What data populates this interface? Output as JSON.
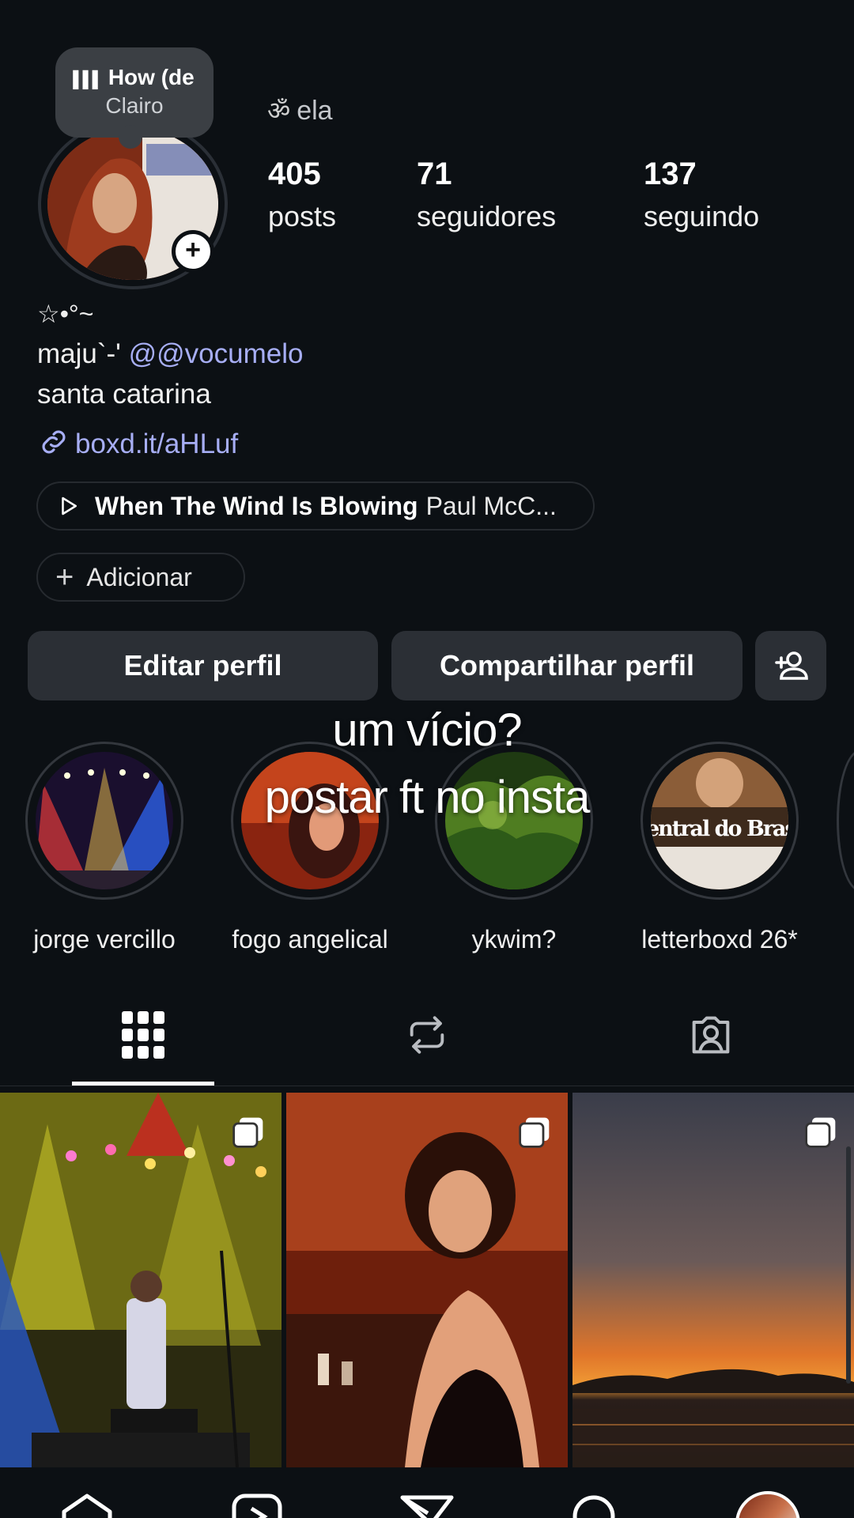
{
  "profile": {
    "note": {
      "title": "How (de",
      "artist": "Clairo"
    },
    "pronoun_icon": "ॐ",
    "pronoun": "ela",
    "stats": [
      {
        "value": "405",
        "label": "posts"
      },
      {
        "value": "71",
        "label": "seguidores"
      },
      {
        "value": "137",
        "label": "seguindo"
      }
    ],
    "bio_symbols": "☆•°~",
    "name": "maju`-'",
    "threads_handle": "@vocumelo",
    "location": "santa catarina",
    "link": "boxd.it/aHLuf",
    "music": {
      "title": "When The Wind Is Blowing",
      "artist": "Paul McC..."
    },
    "add_label": "Adicionar"
  },
  "buttons": {
    "edit": "Editar perfil",
    "share": "Compartilhar perfil"
  },
  "overlay": {
    "line1": "um vício?",
    "line2": "postar ft no insta"
  },
  "highlights": [
    {
      "label": "jorge vercillo"
    },
    {
      "label": "fogo angelical"
    },
    {
      "label": "ykwim?"
    },
    {
      "label": "letterboxd 26*",
      "image_text": "entral do Brasi"
    }
  ],
  "tabs": [
    "grid-icon",
    "reposts-icon",
    "tagged-icon"
  ],
  "nav": [
    "home-icon",
    "reels-icon",
    "messages-icon",
    "search-icon",
    "profile-avatar"
  ]
}
